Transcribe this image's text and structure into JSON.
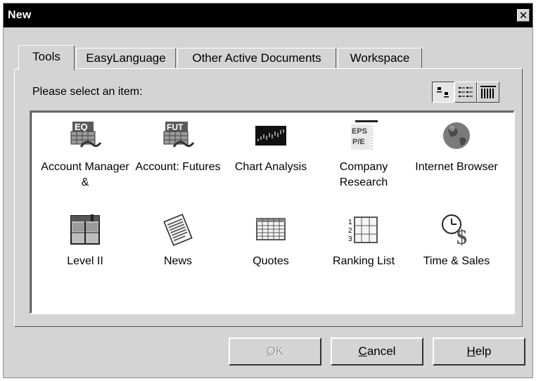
{
  "window": {
    "title": "New",
    "close_glyph": "✕"
  },
  "tabs": [
    {
      "label": "Tools",
      "active": true
    },
    {
      "label": "EasyLanguage",
      "active": false
    },
    {
      "label": "Other Active Documents",
      "active": false
    },
    {
      "label": "Workspace",
      "active": false
    }
  ],
  "prompt": "Please select an item:",
  "view_buttons": [
    {
      "name": "large-icons-view",
      "icon": "large-icons-icon",
      "pressed": true
    },
    {
      "name": "list-view",
      "icon": "list-icon",
      "pressed": false
    },
    {
      "name": "details-view",
      "icon": "details-icon",
      "pressed": false
    }
  ],
  "items": [
    {
      "label": "Account Manager &",
      "icon": "account-manager-eq-icon"
    },
    {
      "label": "Account: Futures",
      "icon": "account-futures-icon"
    },
    {
      "label": "Chart Analysis",
      "icon": "chart-analysis-icon"
    },
    {
      "label": "Company Research",
      "icon": "company-research-icon"
    },
    {
      "label": "Internet Browser",
      "icon": "internet-browser-globe-icon"
    },
    {
      "label": "Level II",
      "icon": "level-ii-icon"
    },
    {
      "label": "News",
      "icon": "news-icon"
    },
    {
      "label": "Quotes",
      "icon": "quotes-grid-icon"
    },
    {
      "label": "Ranking List",
      "icon": "ranking-list-icon"
    },
    {
      "label": "Time & Sales",
      "icon": "time-and-sales-icon"
    }
  ],
  "buttons": {
    "ok": {
      "label": "OK",
      "mnemonic": "O",
      "rest": "K",
      "enabled": false
    },
    "cancel": {
      "label": "Cancel",
      "mnemonic": "C",
      "rest": "ancel",
      "enabled": true
    },
    "help": {
      "label": "Help",
      "mnemonic": "H",
      "rest": "elp",
      "enabled": true
    }
  }
}
